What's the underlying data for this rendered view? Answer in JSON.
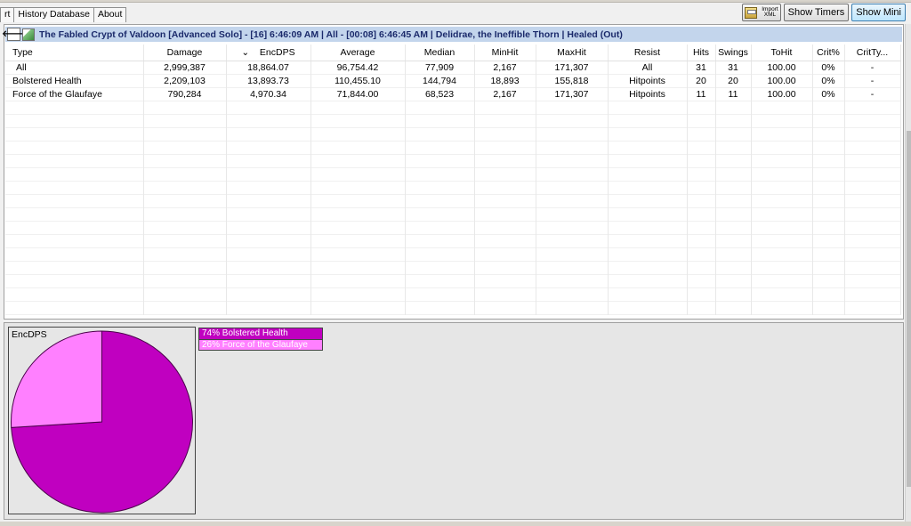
{
  "tabs": [
    "rt",
    "History Database",
    "About"
  ],
  "toolbar": {
    "import_line1": "Import",
    "import_line2": "XML",
    "show_timers": "Show Timers",
    "show_mini": "Show Mini"
  },
  "encounter": {
    "title": "The Fabled Crypt of Valdoon [Advanced Solo] - [16] 6:46:09 AM | All - [00:08] 6:46:45 AM | Delidrae, the Ineffible Thorn | Healed (Out)"
  },
  "table": {
    "sort_indicator": "⌄",
    "columns": [
      "Type",
      "Damage",
      "EncDPS",
      "Average",
      "Median",
      "MinHit",
      "MaxHit",
      "Resist",
      "Hits",
      "Swings",
      "ToHit",
      "Crit%",
      "CritTy..."
    ],
    "rows": [
      [
        "All",
        "2,999,387",
        "18,864.07",
        "96,754.42",
        "77,909",
        "2,167",
        "171,307",
        "All",
        "31",
        "31",
        "100.00",
        "0%",
        "-"
      ],
      [
        "Bolstered Health",
        "2,209,103",
        "13,893.73",
        "110,455.10",
        "144,794",
        "18,893",
        "155,818",
        "Hitpoints",
        "20",
        "20",
        "100.00",
        "0%",
        "-"
      ],
      [
        "Force of the Glaufaye",
        "790,284",
        "4,970.34",
        "71,844.00",
        "68,523",
        "2,167",
        "171,307",
        "Hitpoints",
        "11",
        "11",
        "100.00",
        "0%",
        "-"
      ]
    ]
  },
  "pie": {
    "title": "EncDPS",
    "slices": [
      {
        "label": "74%  Bolstered Health",
        "fraction": 0.74,
        "color": "#c000c0"
      },
      {
        "label": "26%  Force of the Glaufaye",
        "fraction": 0.26,
        "color": "#ff80ff"
      }
    ]
  }
}
